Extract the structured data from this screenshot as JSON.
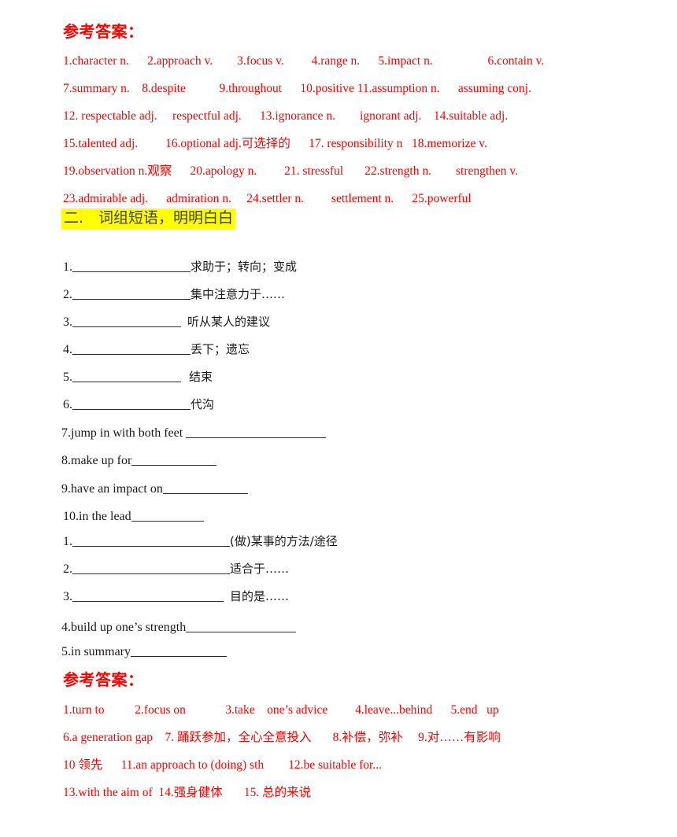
{
  "document": {
    "type": "english-vocabulary-worksheet-answer-key",
    "colors": {
      "answer_red": "#ff0000",
      "highlight_yellow": "#ffff00",
      "highlight_text": "#3f3f3f",
      "body_black": "#1a1a1a",
      "page_background": "#ffffff"
    }
  },
  "answer_key_top": {
    "heading": "参考答案：",
    "lines": [
      "1.character n.      2.approach v.        3.focus v.         4.range n.      5.impact n.                  6.contain v.",
      "7.summary n.    8.despite           9.throughout      10.positive 11.assumption n.      assuming conj.",
      "12. respectable adj.     respectful adj.      13.ignorance n.        ignorant adj.    14.suitable adj.",
      "15.talented adj.         16.optional adj.可选择的      17. responsibility n   18.memorize v.",
      "19.observation n.观察      20.apology n.         21. stressful       22.strength n.        strengthen v.",
      "23.admirable adj.      admiration n.     24.settler n.         settlement n.      25.powerful"
    ]
  },
  "section_two": {
    "header": "二.　词组短语，明明白白"
  },
  "exercise_group_one": [
    {
      "num": "1.",
      "blank_width": 150,
      "meaning": "求助于；转向；变成",
      "gap_before_meaning": 0
    },
    {
      "num": "2.",
      "blank_width": 150,
      "meaning": "集中注意力于……",
      "gap_before_meaning": 0
    },
    {
      "num": "3.",
      "blank_width": 138,
      "meaning": "听从某人的建议",
      "gap_before_meaning": 8
    },
    {
      "num": "4.",
      "blank_width": 150,
      "meaning": "丢下；遗忘",
      "gap_before_meaning": 0
    },
    {
      "num": "5.",
      "blank_width": 138,
      "meaning": "结束",
      "gap_before_meaning": 10
    },
    {
      "num": "6.",
      "blank_width": 150,
      "meaning": "代沟",
      "gap_before_meaning": 0
    }
  ],
  "exercise_group_two": [
    {
      "num": "7.",
      "phrase": "jump in with both feet ",
      "blank_width": 178
    },
    {
      "num": "8.",
      "phrase": "make up for",
      "blank_width": 108
    },
    {
      "num": "9.",
      "phrase": "have an impact on",
      "blank_width": 108
    },
    {
      "num": "10.",
      "phrase": "in the lead",
      "blank_width": 92
    }
  ],
  "exercise_group_three": [
    {
      "num": "1.",
      "blank_width": 200,
      "meaning": "(做)某事的方法/途径",
      "gap_before_meaning": 0
    },
    {
      "num": "2.",
      "blank_width": 200,
      "meaning": "适合于……",
      "gap_before_meaning": 0
    },
    {
      "num": "3.",
      "blank_width": 192,
      "meaning": "目的是……",
      "gap_before_meaning": 8
    }
  ],
  "exercise_group_four": [
    {
      "num": "4.",
      "phrase": "build up one’s strength",
      "blank_width": 140
    },
    {
      "num": "5.",
      "phrase": "in summary",
      "blank_width": 122
    }
  ],
  "answer_key_bottom": {
    "heading": "参考答案：",
    "lines": [
      "1.turn to          2.focus on             3.take    one’s advice         4.leave...behind      5.end   up",
      "6.a generation gap    7. 踊跃参加，全心全意投入       8.补偿，弥补     9.对……有影响",
      "10 领先      11.an approach to (doing) sth        12.be suitable for...",
      "13.with the aim of  14.强身健体       15. 总的来说"
    ]
  }
}
